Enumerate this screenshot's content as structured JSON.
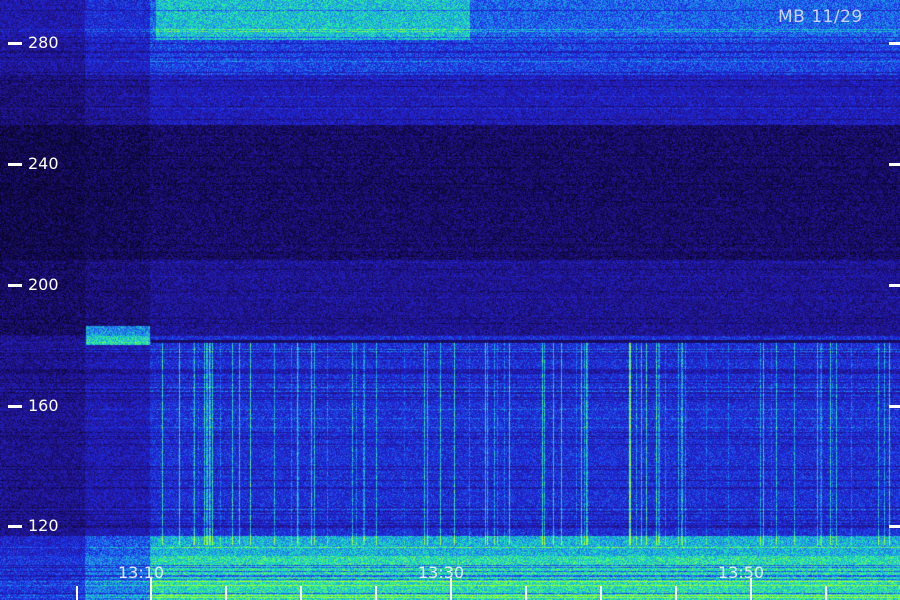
{
  "station_label": "MB 11/29",
  "y_axis": {
    "ticks": [
      "280",
      "240",
      "200",
      "160",
      "120"
    ]
  },
  "x_axis": {
    "ticks": [
      "13:10",
      "13:30",
      "13:50"
    ]
  },
  "colors": {
    "background": "#0a0633",
    "low": "#1e1bb0",
    "mid": "#1f8fe0",
    "high": "#1ef0a0",
    "peak": "#9dff30"
  }
}
